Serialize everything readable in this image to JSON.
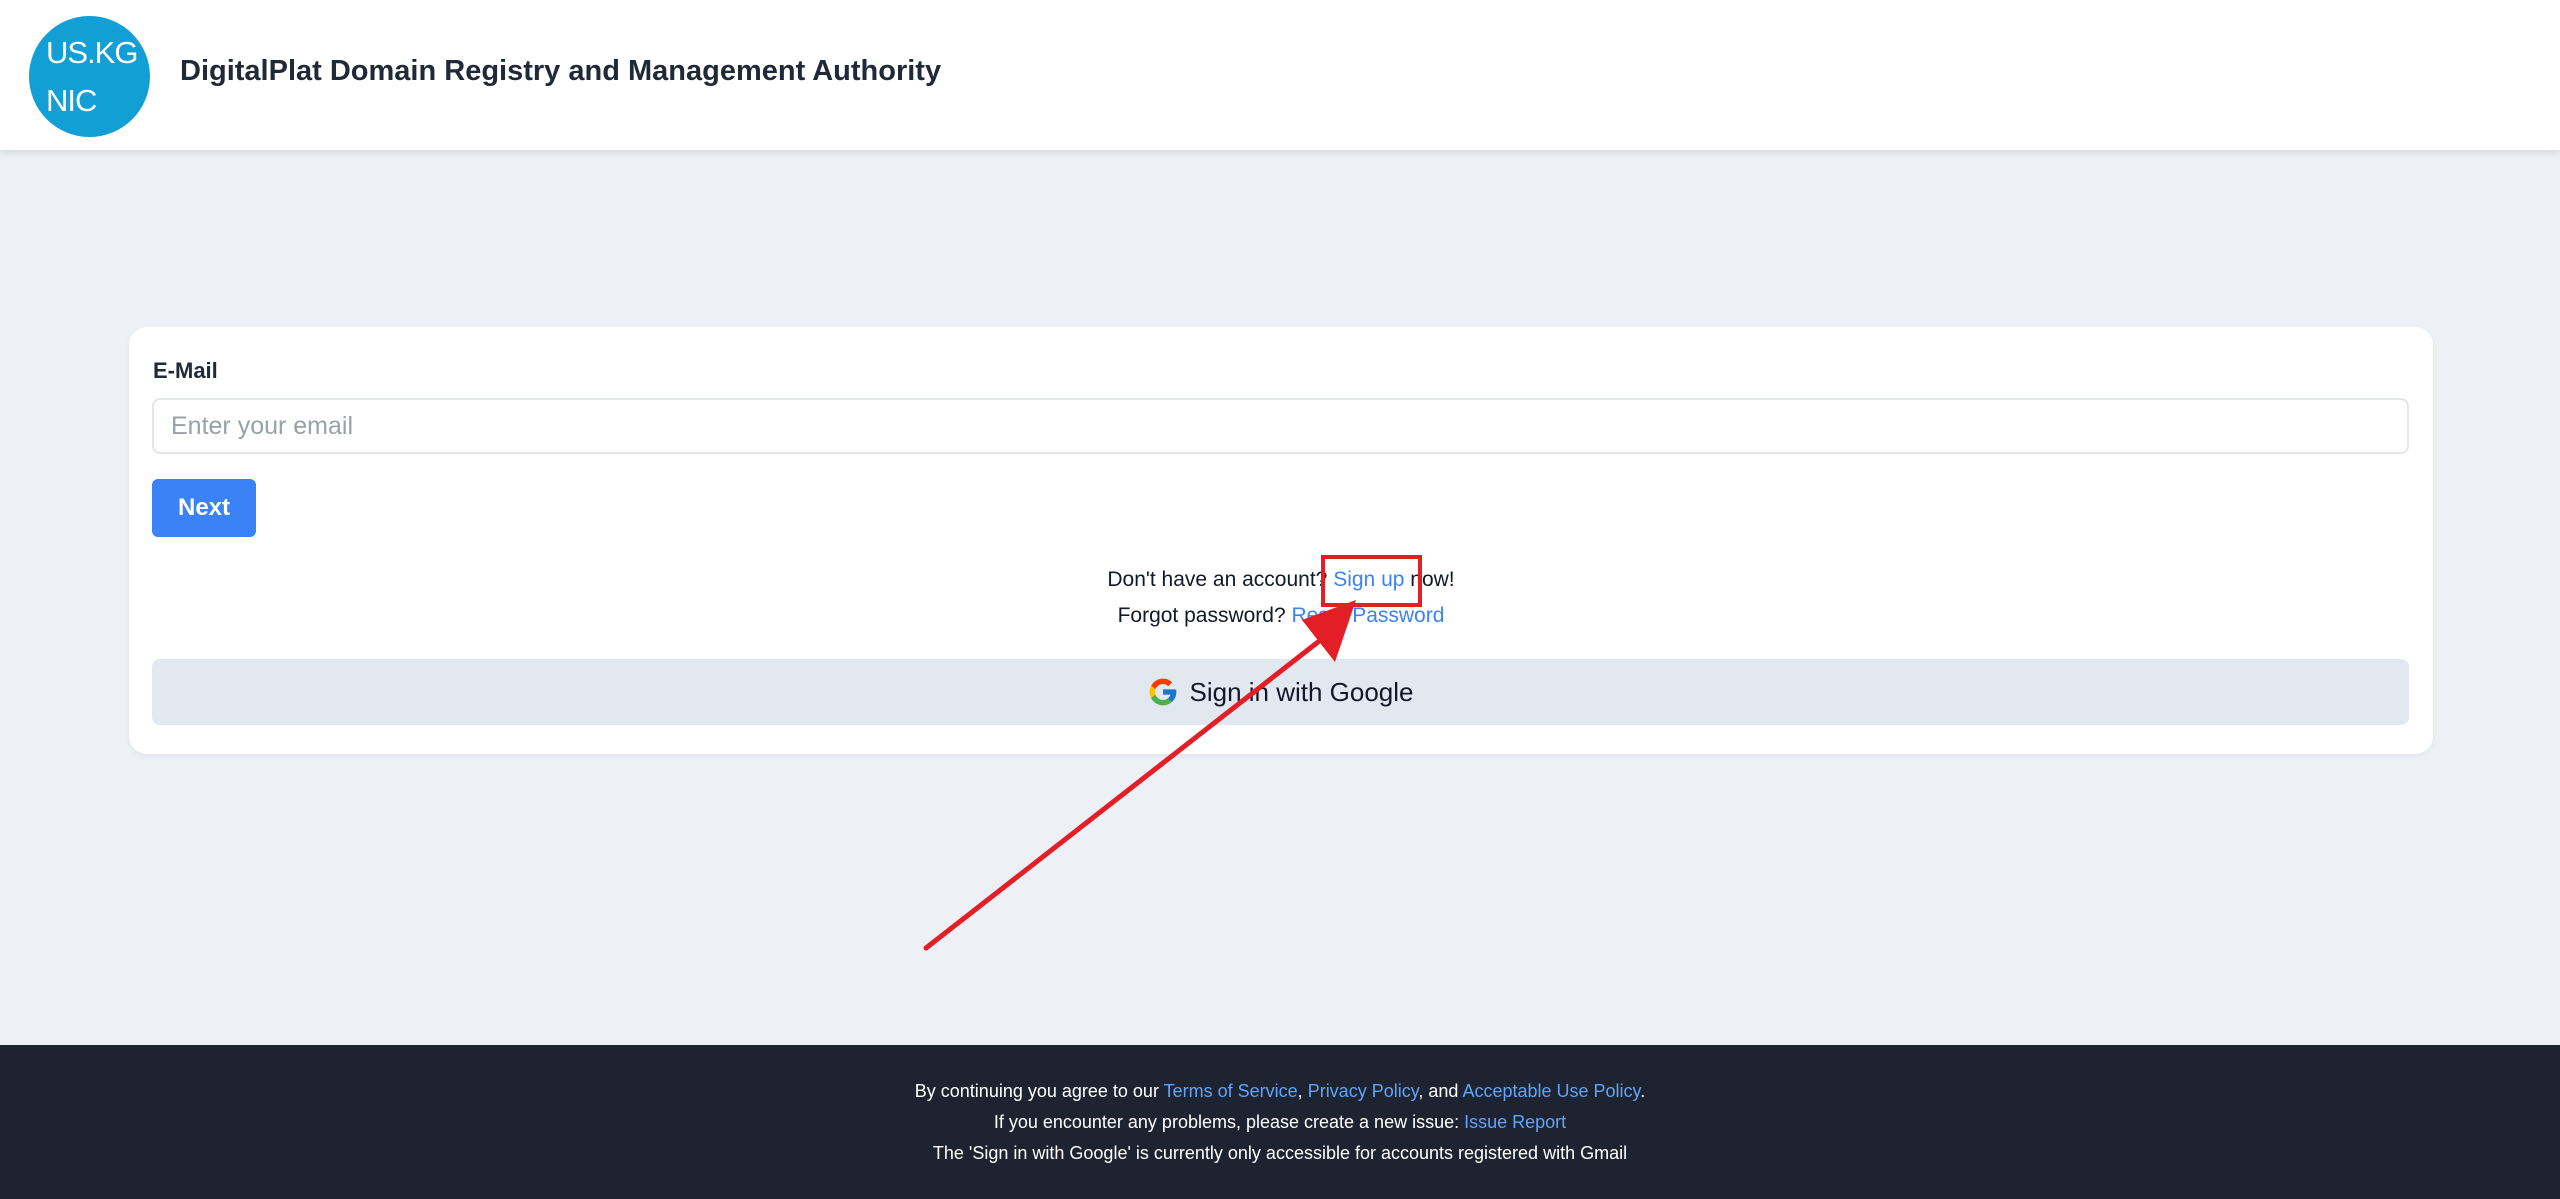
{
  "header": {
    "logo_line1": "US.KG",
    "logo_line2": "NIC",
    "title": "DigitalPlat Domain Registry and Management Authority"
  },
  "form": {
    "email_label": "E-Mail",
    "email_placeholder": "Enter your email",
    "email_value": "",
    "next_label": "Next",
    "signup_prefix": "Don't have an account? ",
    "signup_link": "Sign up",
    "signup_suffix": " now!",
    "forgot_prefix": "Forgot password? ",
    "reset_link": "Reset Password",
    "google_label": "Sign in with Google"
  },
  "footer": {
    "line1_prefix": "By continuing you agree to our ",
    "terms_link": "Terms of Service",
    "sep1": ", ",
    "privacy_link": "Privacy Policy",
    "sep2": ", and ",
    "aup_link": "Acceptable Use Policy",
    "line1_end": ".",
    "line2_prefix": "If you encounter any problems, please create a new issue: ",
    "issue_link": "Issue Report",
    "line3": "The 'Sign in with Google' is currently only accessible for accounts registered with Gmail"
  },
  "colors": {
    "brand_blue": "#3b82f6",
    "logo_blue": "#119fd6",
    "annotation_red": "#e41e26",
    "footer_bg": "#1d2330"
  },
  "icons": {
    "google": "google-g-icon",
    "annotation": "red-arrow-annotation"
  }
}
